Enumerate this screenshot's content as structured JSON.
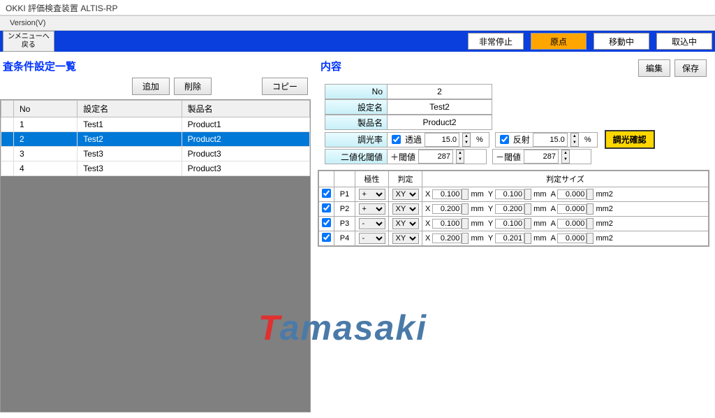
{
  "window_title": "OKKI 評価検査装置 ALTIS-RP",
  "menu": {
    "version": "Version(V)"
  },
  "toolbar": {
    "back_line1": "ンメニューへ",
    "back_line2": "戻る",
    "estop": "非常停止",
    "origin": "原点",
    "moving": "移動中",
    "loading": "取込中"
  },
  "left": {
    "title": "査条件設定一覧",
    "add": "追加",
    "delete": "削除",
    "copy": "コピー",
    "headers": {
      "no": "No",
      "setting": "設定名",
      "product": "製品名"
    },
    "rows": [
      {
        "no": "1",
        "setting": "Test1",
        "product": "Product1",
        "selected": false
      },
      {
        "no": "2",
        "setting": "Test2",
        "product": "Product2",
        "selected": true
      },
      {
        "no": "3",
        "setting": "Test3",
        "product": "Product3",
        "selected": false
      },
      {
        "no": "4",
        "setting": "Test3",
        "product": "Product3",
        "selected": false
      }
    ]
  },
  "right": {
    "title": "内容",
    "edit": "編集",
    "save": "保存",
    "labels": {
      "no": "No",
      "setting": "設定名",
      "product": "製品名",
      "dimming": "調光率",
      "transmit": "透過",
      "reflect": "反射",
      "binarize": "二値化閾値",
      "plus": "＋閾値",
      "minus": "－閾値",
      "confirm": "調光確認",
      "percent": "%",
      "polarity": "極性",
      "judge": "判定",
      "judgesize": "判定サイズ",
      "mm": "mm",
      "mm2": "mm2"
    },
    "values": {
      "no": "2",
      "setting": "Test2",
      "product": "Product2",
      "transmit_chk": true,
      "transmit_val": "15.0",
      "reflect_chk": true,
      "reflect_val": "15.0",
      "plus_val": "287",
      "minus_val": "287"
    },
    "prows": [
      {
        "chk": true,
        "name": "P1",
        "pol": "+",
        "judge": "XY",
        "x": "0.100",
        "y": "0.100",
        "a": "0.000"
      },
      {
        "chk": true,
        "name": "P2",
        "pol": "+",
        "judge": "XY",
        "x": "0.200",
        "y": "0.200",
        "a": "0.000"
      },
      {
        "chk": true,
        "name": "P3",
        "pol": "-",
        "judge": "XY",
        "x": "0.100",
        "y": "0.100",
        "a": "0.000"
      },
      {
        "chk": true,
        "name": "P4",
        "pol": "-",
        "judge": "XY",
        "x": "0.200",
        "y": "0.201",
        "a": "0.000"
      }
    ]
  },
  "watermark": {
    "t": "T",
    "rest": "amasaki"
  }
}
